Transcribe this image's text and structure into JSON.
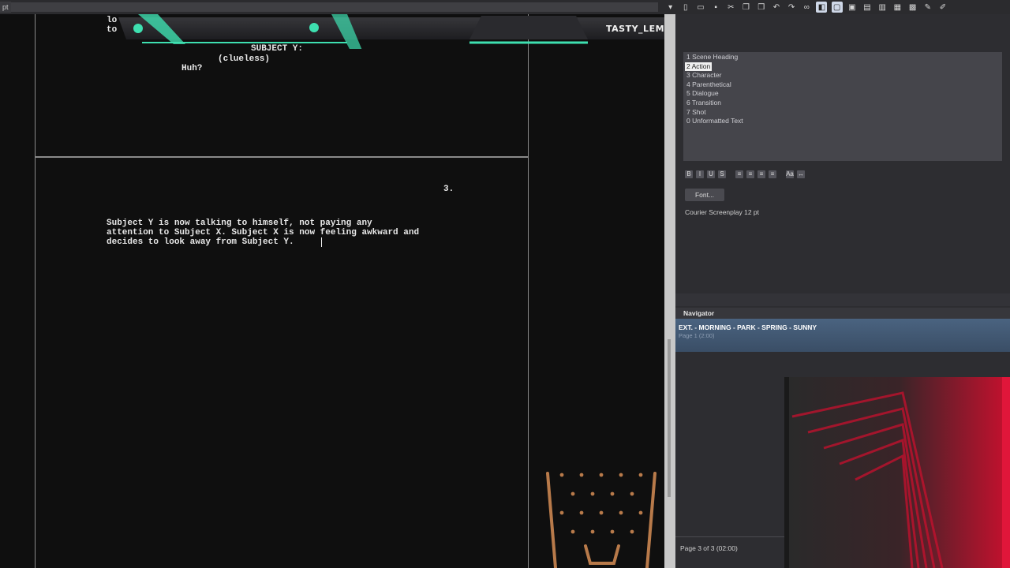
{
  "app": {
    "tab_label": "pt"
  },
  "overlay": {
    "streamer_name": "TASTY_LEMPONS"
  },
  "toolbar": {
    "icons": [
      "dropdown-icon",
      "new-file-icon",
      "open-folder-icon",
      "save-icon",
      "cut-icon",
      "copy-icon",
      "paste-icon",
      "undo-icon",
      "redo-icon",
      "find-icon",
      "paint-icon",
      "view-normal-icon",
      "view-page-icon",
      "view-split-icon",
      "view-wide-icon",
      "layout-icon",
      "grid-icon",
      "tools-icon",
      "edit-icon"
    ],
    "glyphs": [
      "▾",
      "▯",
      "▭",
      "▪",
      "✂",
      "❐",
      "❒",
      "↶",
      "↷",
      "∞",
      "◧",
      "▢",
      "▣",
      "▤",
      "▥",
      "▦",
      "▩",
      "✎",
      "✐"
    ]
  },
  "script": {
    "page2": {
      "top_lines": [
        "lo",
        "to"
      ],
      "character": "SUBJECT Y:",
      "parenthetical": "(clueless)",
      "dialogue": "Huh?"
    },
    "page3": {
      "page_number": "3.",
      "action_lines": [
        "Subject Y is now talking to himself, not paying any",
        "attention to Subject X. Subject X is now feeling awkward and",
        "decides to look away from Subject Y."
      ]
    }
  },
  "elements": {
    "items": [
      "1 Scene Heading",
      "2 Action",
      "3 Character",
      "4 Parenthetical",
      "5 Dialogue",
      "6 Transition",
      "7 Shot",
      "0 Unformatted Text"
    ],
    "selected_index": 1
  },
  "format": {
    "buttons": [
      "B",
      "I",
      "U",
      "S",
      "≡",
      "≡",
      "≡",
      "≡",
      "Aa",
      "↔"
    ],
    "font_button": "Font...",
    "font_info": "Courier Screenplay 12 pt"
  },
  "navigator": {
    "title": "Navigator",
    "scene": "EXT. - MORNING - PARK - SPRING - SUNNY",
    "scene_page": "Page 1 (2:00)"
  },
  "status": {
    "page_status": "Page 3 of 3 (02:00)"
  },
  "colors": {
    "accent": "#3ee0b0",
    "selection": "#4a6380",
    "webcam_red": "#c8102e"
  }
}
